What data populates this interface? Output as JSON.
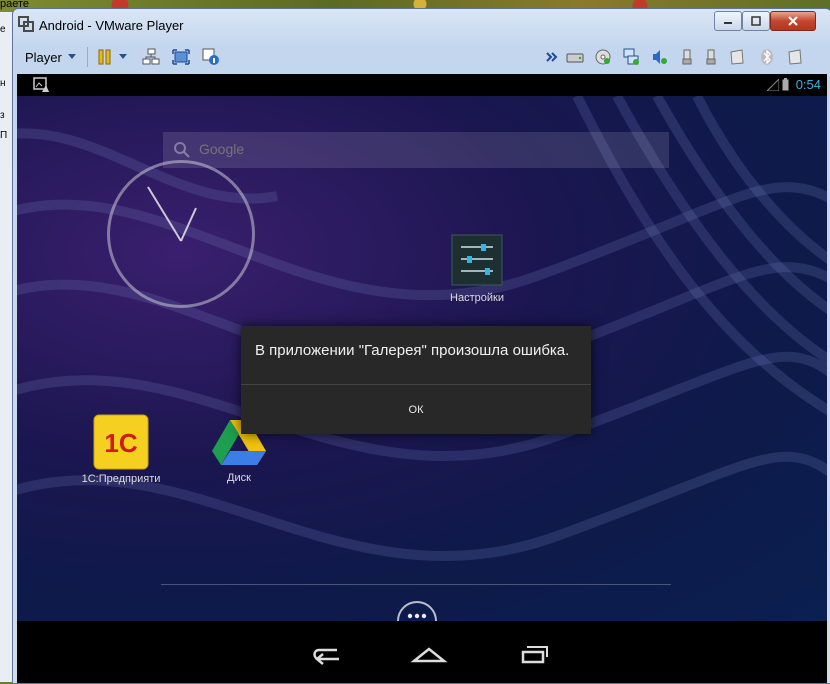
{
  "desktop": {
    "corner_text": "раете",
    "strip_items": [
      "е",
      "",
      "",
      "н",
      "",
      "з",
      "П"
    ]
  },
  "window": {
    "title": "Android - VMware Player"
  },
  "toolbar": {
    "player_label": "Player"
  },
  "android": {
    "status": {
      "time": "0:54"
    },
    "search": {
      "placeholder": "Google"
    },
    "apps": [
      {
        "label": "Настройки"
      },
      {
        "label": "1С:Предприяти"
      },
      {
        "label": "Диск"
      }
    ],
    "dialog": {
      "message": "В приложении \"Галерея\" произошла ошибка.",
      "ok_label": "ОК"
    }
  },
  "colors": {
    "status_accent": "#33b5e5",
    "dialog_bg": "#282828",
    "close_button": "#c3472e"
  }
}
